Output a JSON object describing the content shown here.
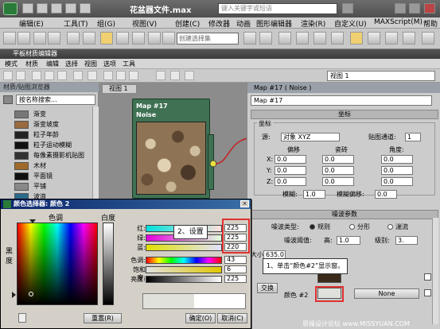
{
  "app": {
    "title": "花盆器文件.max",
    "search_placeholder": "键入关键字或短语"
  },
  "menubar": [
    "编辑(E)",
    "工具(T)",
    "组(G)",
    "视图(V)",
    "创建(C)",
    "修改器",
    "动画",
    "图形编辑器",
    "渲染(R)",
    "自定义(U)",
    "MAXScript(M)",
    "帮助(H)"
  ],
  "main_toolbar": {
    "selection_set": "创建选择集"
  },
  "mat_editor": {
    "title": "平板材质编辑器",
    "menu": [
      "模式",
      "材质",
      "编辑",
      "选择",
      "视图",
      "选项",
      "工具"
    ],
    "view_select": "视图 1"
  },
  "browser": {
    "header": "材质/贴图浏览器",
    "search": "按名称搜索...",
    "items": [
      {
        "label": "渐变",
        "swatch": "#777777"
      },
      {
        "label": "渐变坡度",
        "swatch": "#9a6a40"
      },
      {
        "label": "粒子年龄",
        "swatch": "#222222"
      },
      {
        "label": "粒子运动模糊",
        "swatch": "#111111"
      },
      {
        "label": "每像素摄影机贴图",
        "swatch": "#333333"
      },
      {
        "label": "木材",
        "swatch": "#a06a2a"
      },
      {
        "label": "平面镜",
        "swatch": "#101010"
      },
      {
        "label": "平铺",
        "swatch": "#888888"
      },
      {
        "label": "波浪",
        "swatch": "#2a6a8a"
      }
    ]
  },
  "view": {
    "tab": "视图 1",
    "node_title": "Map #17",
    "node_subtitle": "Noise"
  },
  "params": {
    "header": "Map #17  ( Noise )",
    "name": "Map #17",
    "coords": {
      "rollout": "坐标",
      "group": "坐标",
      "source_label": "源:",
      "source_value": "对象 XYZ",
      "mapchannel_label": "贴图通道:",
      "mapchannel_value": "1",
      "offset_label": "偏移",
      "tiling_label": "瓷砖",
      "angle_label": "角度:",
      "rows": [
        {
          "axis": "X:",
          "offset": "0.0",
          "tiling": "0.0",
          "angle": "0.0"
        },
        {
          "axis": "Y:",
          "offset": "0.0",
          "tiling": "0.0",
          "angle": "0.0"
        },
        {
          "axis": "Z:",
          "offset": "0.0",
          "tiling": "0.0",
          "angle": "0.0"
        }
      ],
      "blur_label": "模糊:",
      "blur_value": "1.0",
      "bluroffset_label": "模糊偏移:",
      "bluroffset_value": "0.0"
    },
    "noise": {
      "rollout": "噪波参数",
      "type_label": "噪波类型:",
      "type_regular": "规则",
      "type_fractal": "分形",
      "type_turbulence": "湍流",
      "threshold_label": "噪波阈值:",
      "high_label": "高:",
      "high_value": "1.0",
      "levels_label": "级别:",
      "levels_value": "3.",
      "size_label": "大小:",
      "size_value": "635.0",
      "swap_label": "交换",
      "color2_label": "颜色 #2",
      "none_label": "None"
    }
  },
  "color_picker": {
    "title": "颜色选择器: 颜色 2",
    "hue_label": "色调",
    "whiteness_label": "白度",
    "black_label": "黑度",
    "red_label": "红:",
    "green_label": "绿:",
    "blue_label": "蓝:",
    "hue_label2": "色调:",
    "sat_label": "饱和度:",
    "val_label": "亮度:",
    "red": "225",
    "green": "225",
    "blue": "220",
    "hue": "43",
    "saturation": "6",
    "value": "225",
    "reset_label": "重置(R)",
    "ok_label": "确定(O)",
    "cancel_label": "取消(C)",
    "current_color": "#e1e1dc"
  },
  "annotations": {
    "step1": "1、单击“颜色#2”显示窗。",
    "step2": "2、设置"
  },
  "watermark": "思缘设计论坛 www.MISSYUAN.COM"
}
